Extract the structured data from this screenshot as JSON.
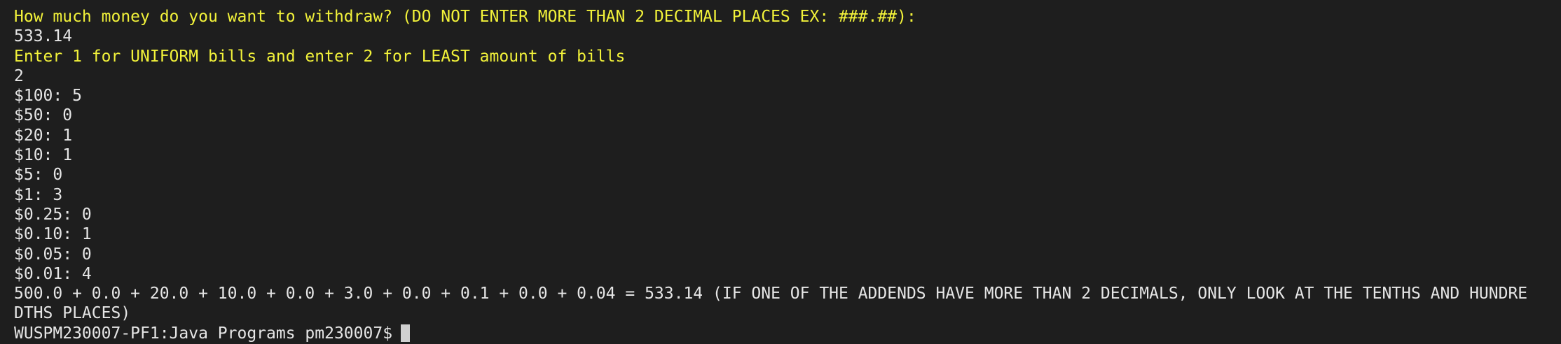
{
  "colors": {
    "background": "#1e1e1e",
    "prompt": "#f2f23a",
    "output": "#e6e6e6",
    "cursor": "#d0d0d0"
  },
  "terminal": {
    "prompt_withdraw": "How much money do you want to withdraw? (DO NOT ENTER MORE THAN 2 DECIMAL PLACES EX: ###.##):",
    "input_amount": "533.14",
    "prompt_mode": "Enter 1 for UNIFORM bills and enter 2 for LEAST amount of bills",
    "input_mode": "2",
    "bills": [
      "$100: 5",
      "$50: 0",
      "$20: 1",
      "$10: 1",
      "$5: 0",
      "$1: 3",
      "$0.25: 0",
      "$0.10: 1",
      "$0.05: 0",
      "$0.01: 4"
    ],
    "sum_line_1": "500.0 + 0.0 + 20.0 + 10.0 + 0.0 + 3.0 + 0.0 + 0.1 + 0.0 + 0.04 = 533.14 (IF ONE OF THE ADDENDS HAVE MORE THAN 2 DECIMALS, ONLY LOOK AT THE TENTHS AND HUNDRE",
    "sum_line_2": "DTHS PLACES)",
    "shell_prompt": "WUSPM230007-PF1:Java Programs pm230007$"
  }
}
